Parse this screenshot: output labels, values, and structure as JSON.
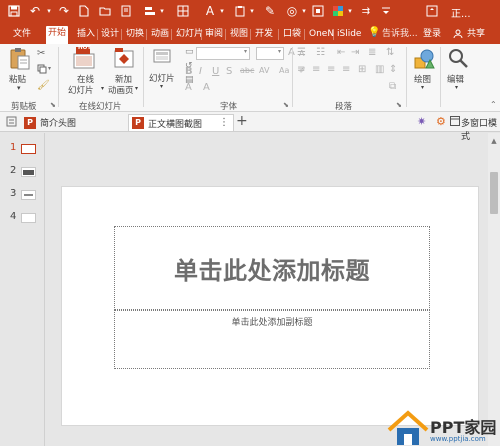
{
  "window": {
    "title": "正..."
  },
  "tabs": [
    {
      "label": "文件",
      "active": false
    },
    {
      "label": "开始",
      "active": true
    },
    {
      "label": "插入",
      "active": false
    },
    {
      "label": "设计",
      "active": false
    },
    {
      "label": "切换",
      "active": false
    },
    {
      "label": "动画",
      "active": false
    },
    {
      "label": "幻灯片",
      "active": false
    },
    {
      "label": "审阅",
      "active": false
    },
    {
      "label": "视图",
      "active": false
    },
    {
      "label": "开发",
      "active": false
    },
    {
      "label": "口袋",
      "active": false
    },
    {
      "label": "OneN",
      "active": false
    },
    {
      "label": "iSlide",
      "active": false
    }
  ],
  "tell_me": "告诉我...",
  "login": "登录",
  "share": "共享",
  "ribbon": {
    "paste": "粘贴",
    "clipboard_group": "剪贴板",
    "online_slide": "在线\n幻灯片",
    "online_slide_l1": "在线",
    "online_slide_l2": "幻灯片",
    "hot_badge": "HOT",
    "new_anim_l1": "新加",
    "new_anim_l2": "动画页",
    "online_group": "在线幻灯片",
    "slides_btn": "幻灯片",
    "font_group": "字体",
    "paragraph_group": "段落",
    "drawing": "绘图",
    "editing": "编辑",
    "bold": "B",
    "italic": "I",
    "underline": "U",
    "strike": "S",
    "abc": "abc",
    "av": "AV",
    "aa": "Aa",
    "font_a": "A"
  },
  "doc_tabs": [
    {
      "label": "简介头图",
      "active": false
    },
    {
      "label": "正文横图截图",
      "active": true
    }
  ],
  "multi_window": "多窗口模式",
  "thumbnails": [
    {
      "num": "1",
      "selected": true
    },
    {
      "num": "2",
      "selected": false
    },
    {
      "num": "3",
      "selected": false
    },
    {
      "num": "4",
      "selected": false
    }
  ],
  "slide": {
    "title_placeholder": "单击此处添加标题",
    "subtitle_placeholder": "单击此处添加副标题"
  },
  "watermark": {
    "text": "PPT家园",
    "url": "www.pptjia.com"
  },
  "colors": {
    "accent": "#c43e1c"
  }
}
